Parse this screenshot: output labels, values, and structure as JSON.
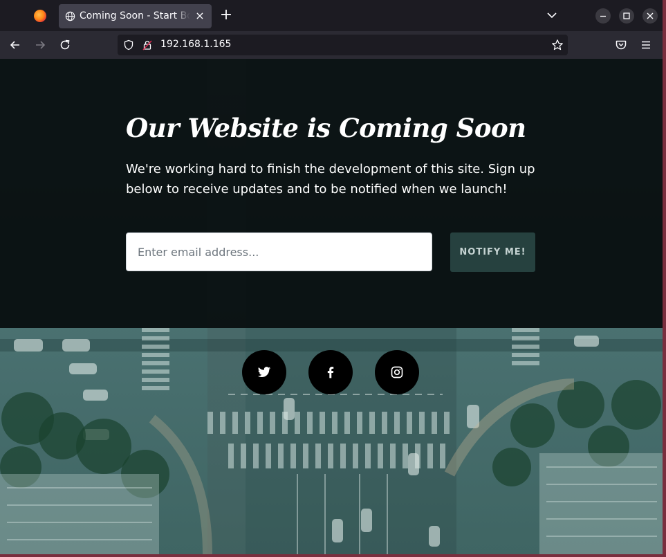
{
  "browser": {
    "tab_title": "Coming Soon - Start Bootstrap",
    "tab_close": "×",
    "new_tab": "+",
    "url": "192.168.1.165",
    "icons": [
      "firefox-logo",
      "globe-icon",
      "chevron-down-icon",
      "minimize-icon",
      "maximize-icon",
      "close-icon",
      "back-icon",
      "forward-icon",
      "reload-icon",
      "shield-icon",
      "lock-icon",
      "star-icon",
      "pocket-icon",
      "menu-icon"
    ]
  },
  "page": {
    "heading": "Our Website is Coming Soon",
    "lead": "We're working hard to finish the development of this site. Sign up below to receive updates and to be notified when we launch!",
    "email_placeholder": "Enter email address...",
    "notify_label": "NOTIFY ME!",
    "social": [
      "twitter-icon",
      "facebook-icon",
      "instagram-icon"
    ]
  },
  "colors": {
    "accent": "#26413f",
    "overlay": "#060c0d",
    "browser_bg": "#1c1b22",
    "tab_bg": "#42414d"
  }
}
